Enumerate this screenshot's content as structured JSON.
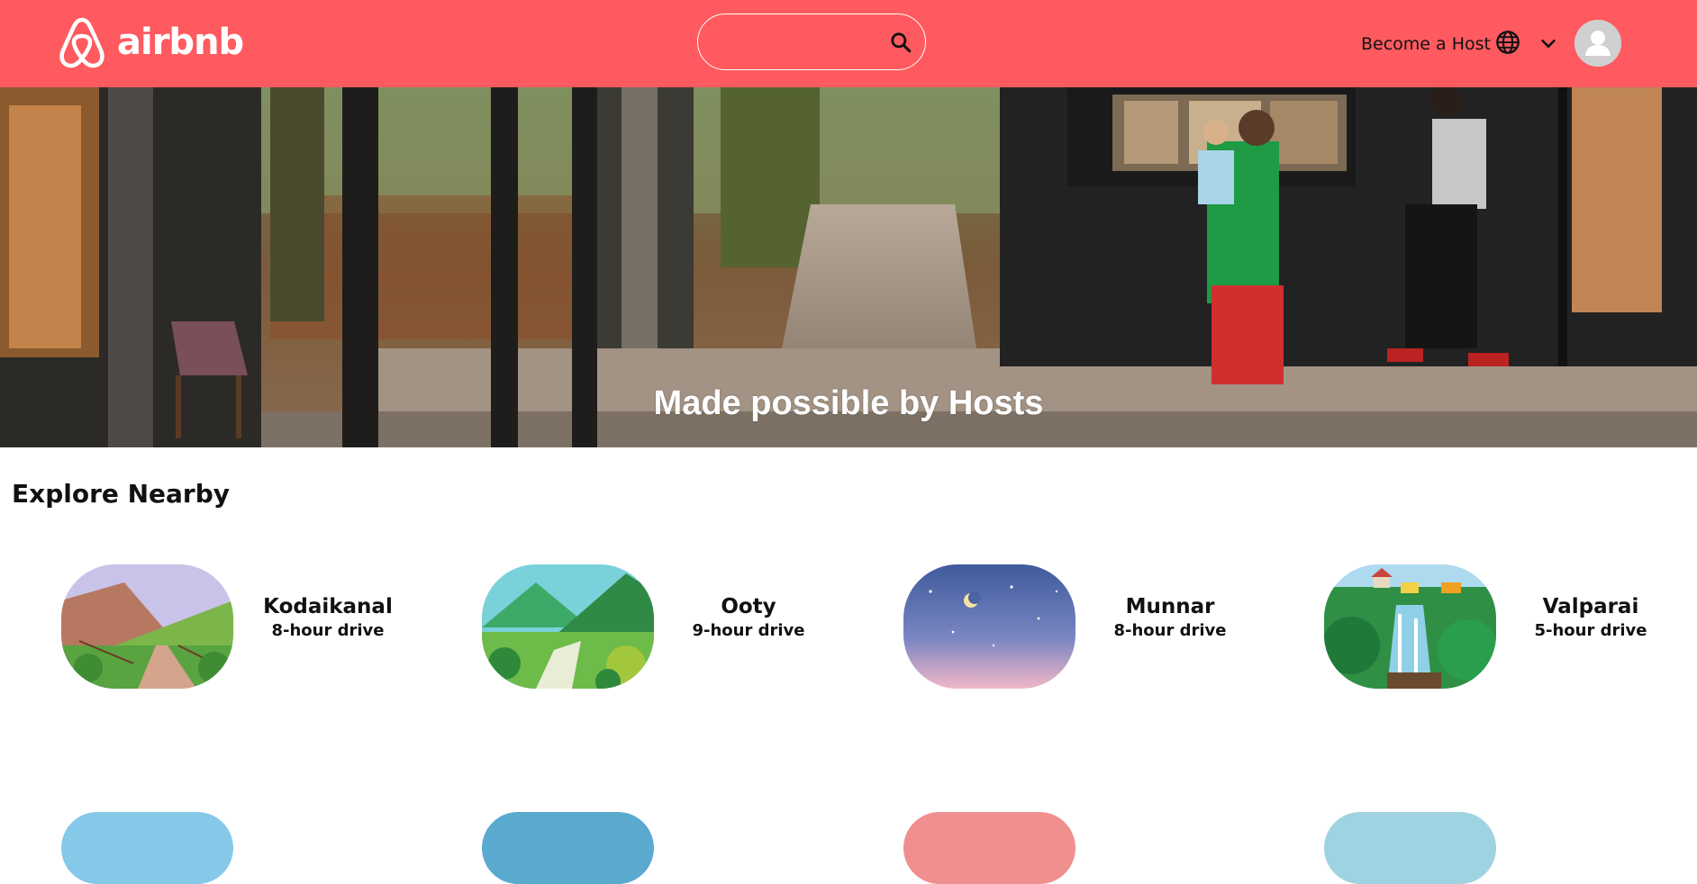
{
  "header": {
    "brand": "airbnb",
    "search_placeholder": "",
    "host_link": "Become a Host",
    "icons": [
      "airbnb-logo-icon",
      "search-icon",
      "globe-icon",
      "chevron-down-icon",
      "avatar-icon"
    ],
    "colors": {
      "header_bg": "#ff5a5f",
      "text": "#111111"
    }
  },
  "hero": {
    "caption": "Made possible by Hosts"
  },
  "explore": {
    "title": "Explore Nearby",
    "items": [
      {
        "name": "Kodaikanal",
        "drive": "8-hour drive"
      },
      {
        "name": "Ooty",
        "drive": "9-hour drive"
      },
      {
        "name": "Munnar",
        "drive": "8-hour drive"
      },
      {
        "name": "Valparai",
        "drive": "5-hour drive"
      }
    ]
  }
}
